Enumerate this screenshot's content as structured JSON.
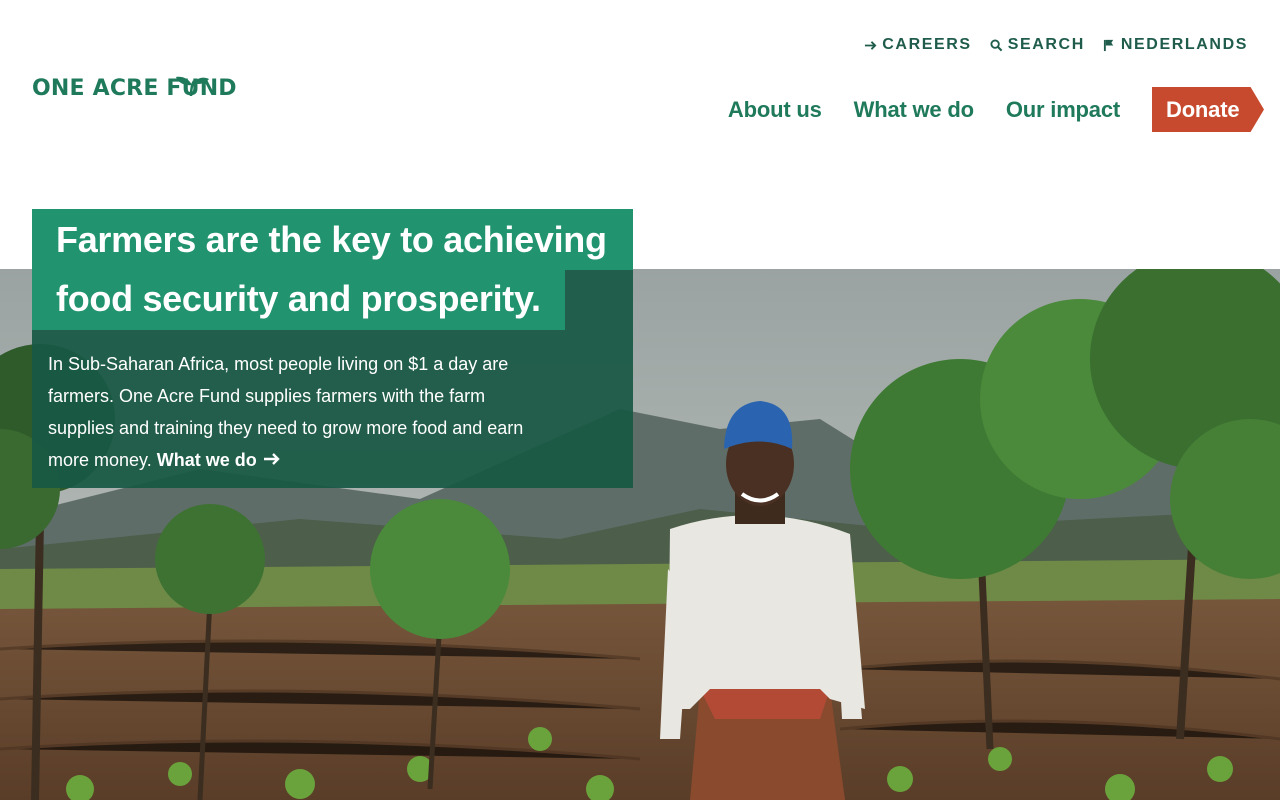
{
  "utility_nav": [
    {
      "label": "CAREERS",
      "icon": "arrow-right-icon"
    },
    {
      "label": "SEARCH",
      "icon": "search-icon"
    },
    {
      "label": "NEDERLANDS",
      "icon": "flag-icon"
    }
  ],
  "logo": {
    "text": "ONE ACRE FUND"
  },
  "main_nav": {
    "about": "About us",
    "what": "What we do",
    "impact": "Our impact",
    "donate": "Donate"
  },
  "hero": {
    "headline_line1": "Farmers are the key to achieving",
    "headline_line2": "food security and prosperity.",
    "intro": "In Sub-Saharan Africa, most people living on $1 a day are farmers. One Acre Fund supplies farmers with the farm supplies and training they need to grow more food and earn more money.",
    "link_label": "What we do"
  },
  "colors": {
    "brand_green": "#1f7a5c",
    "headline_green": "#22936f",
    "dark_green": "#185844",
    "donate_red": "#c84a2e"
  }
}
